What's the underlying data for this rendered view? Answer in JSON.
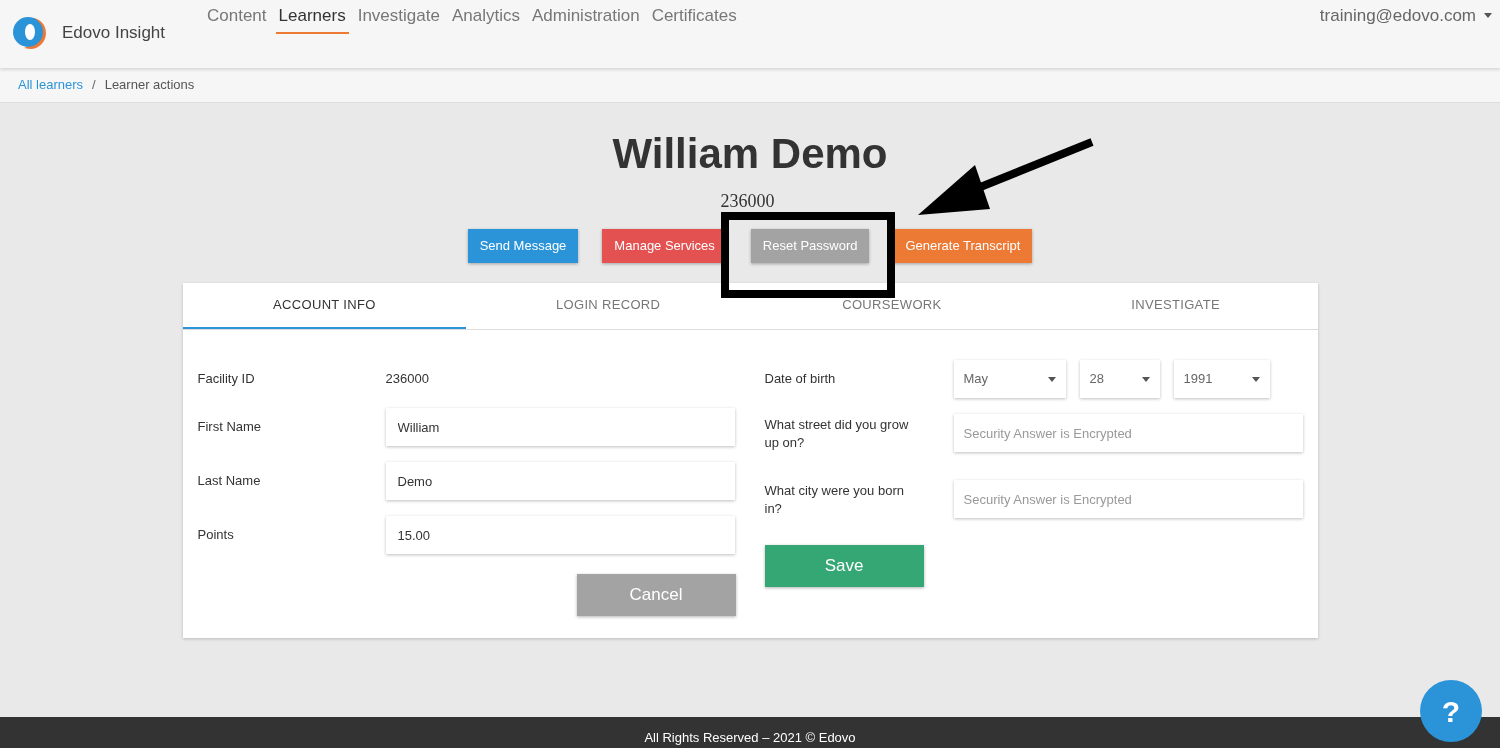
{
  "header": {
    "brand": "Edovo Insight",
    "nav": [
      {
        "label": "Content",
        "selected": false
      },
      {
        "label": "Learners",
        "selected": true
      },
      {
        "label": "Investigate",
        "selected": false
      },
      {
        "label": "Analytics",
        "selected": false
      },
      {
        "label": "Administration",
        "selected": false
      },
      {
        "label": "Certificates",
        "selected": false
      }
    ],
    "user": "training@edovo.com"
  },
  "breadcrumb": {
    "link": "All learners",
    "separator": "/",
    "current": "Learner actions"
  },
  "learner": {
    "name": "William Demo",
    "id": "236000"
  },
  "actions": [
    {
      "label": "Send Message",
      "color": "#2b94d9"
    },
    {
      "label": "Manage Services",
      "color": "#e45151"
    },
    {
      "label": "Reset Password",
      "color": "#a3a3a3"
    },
    {
      "label": "Generate Transcript",
      "color": "#ec7a35"
    }
  ],
  "tabs": [
    {
      "label": "ACCOUNT INFO",
      "selected": true
    },
    {
      "label": "LOGIN RECORD",
      "selected": false
    },
    {
      "label": "COURSEWORK",
      "selected": false
    },
    {
      "label": "INVESTIGATE",
      "selected": false
    }
  ],
  "left_fields": [
    {
      "kind": "text",
      "label": "Facility ID",
      "value": "236000"
    },
    {
      "kind": "input",
      "label": "First Name",
      "value": "William"
    },
    {
      "kind": "input",
      "label": "Last Name",
      "value": "Demo"
    },
    {
      "kind": "input",
      "label": "Points",
      "value": "15.00"
    }
  ],
  "date_of_birth": {
    "label": "Date of birth",
    "month": "May",
    "day": "28",
    "year": "1991"
  },
  "security_questions": [
    {
      "label": "What street did you grow up on?",
      "placeholder": "Security Answer is Encrypted"
    },
    {
      "label": "What city were you born in?",
      "placeholder": "Security Answer is Encrypted"
    }
  ],
  "form_buttons": {
    "cancel": "Cancel",
    "save": "Save"
  },
  "footer": "All Rights Reserved – 2021 © Edovo",
  "help_button": "?"
}
